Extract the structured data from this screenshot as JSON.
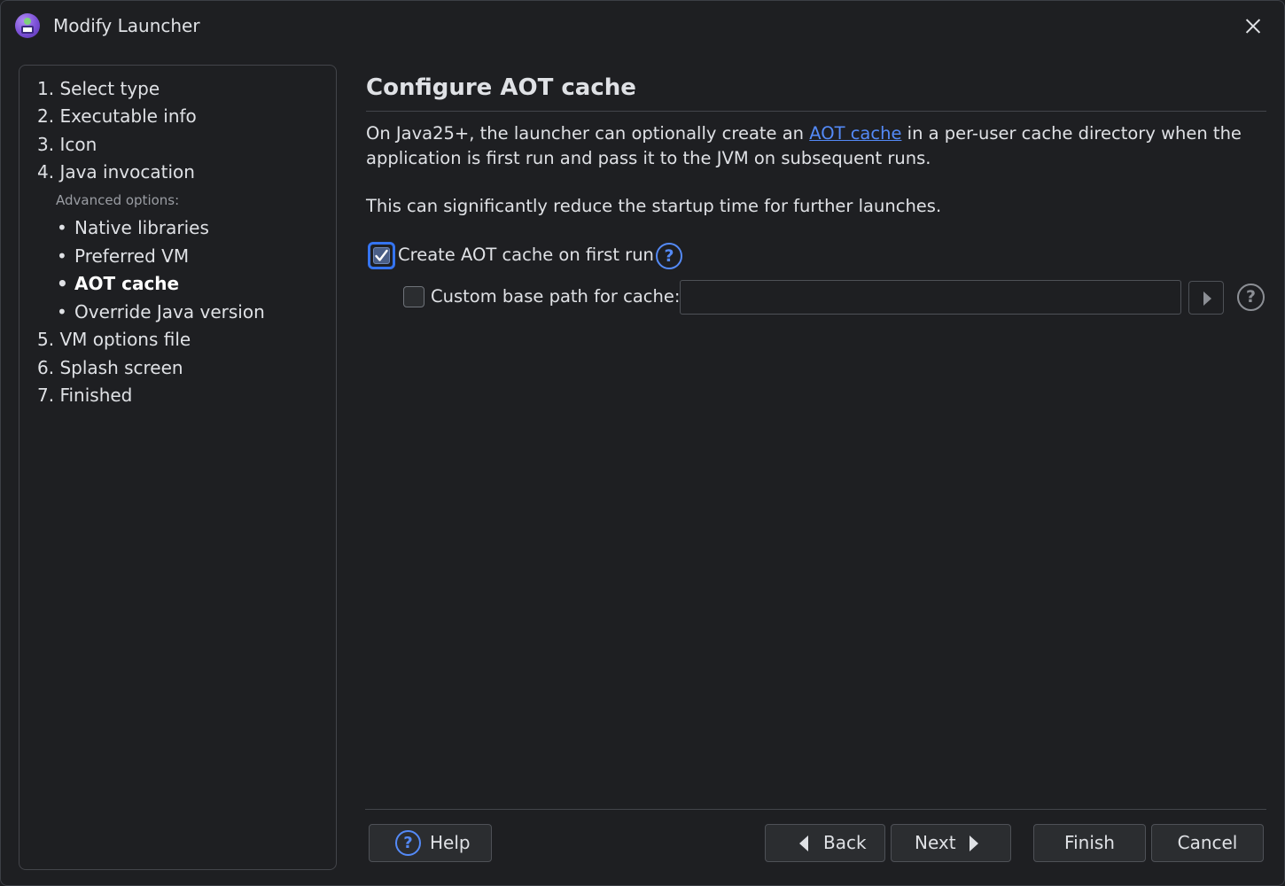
{
  "window": {
    "title": "Modify Launcher"
  },
  "sidebar": {
    "steps": [
      {
        "label": "1. Select type"
      },
      {
        "label": "2. Executable info"
      },
      {
        "label": "3. Icon"
      },
      {
        "label": "4. Java invocation"
      },
      {
        "label": "5. VM options file"
      },
      {
        "label": "6. Splash screen"
      },
      {
        "label": "7. Finished"
      }
    ],
    "advanced_label": "Advanced options:",
    "advanced_items": [
      {
        "label": "Native libraries",
        "active": false
      },
      {
        "label": "Preferred VM",
        "active": false
      },
      {
        "label": "AOT cache",
        "active": true
      },
      {
        "label": "Override Java version",
        "active": false
      }
    ],
    "bullet": "•"
  },
  "main": {
    "title": "Configure AOT cache",
    "description_before_link": "On Java25+, the launcher can optionally create an ",
    "description_link": "AOT cache",
    "description_after_link": " in a per-user cache directory when the application is first run and pass it to the JVM on subsequent runs.",
    "description2": "This can significantly reduce the startup time for further launches.",
    "create_cache_checkbox": {
      "label": "Create AOT cache on first run",
      "checked": true
    },
    "custom_path_checkbox": {
      "label": "Custom base path for cache:",
      "checked": false
    },
    "custom_path_value": "",
    "help_symbol": "?"
  },
  "footer": {
    "help_label": "Help",
    "back_label": "Back",
    "next_label": "Next",
    "finish_label": "Finish",
    "cancel_label": "Cancel"
  },
  "colors": {
    "background": "#1e1f22",
    "accent": "#3574f0",
    "link": "#548af7",
    "text": "#dfe1e5"
  }
}
